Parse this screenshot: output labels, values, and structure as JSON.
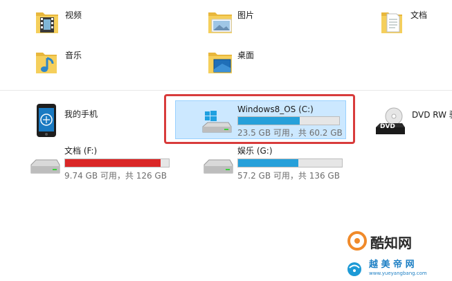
{
  "folders": [
    {
      "name": "视频",
      "icon": "video-folder-icon"
    },
    {
      "name": "图片",
      "icon": "pictures-folder-icon"
    },
    {
      "name": "文档",
      "icon": "documents-folder-icon"
    },
    {
      "name": "音乐",
      "icon": "music-folder-icon"
    },
    {
      "name": "桌面",
      "icon": "desktop-folder-icon"
    }
  ],
  "devices": {
    "phone": {
      "name": "我的手机",
      "icon": "phone-icon"
    },
    "drive_c": {
      "name": "Windows8_OS (C:)",
      "free": "23.5 GB 可用，共 60.2 GB",
      "usage": 0.61,
      "bar_color": "#26a0da"
    },
    "dvd": {
      "name": "DVD RW 驱",
      "icon": "dvd-drive-icon",
      "badge": "DVD"
    },
    "drive_f": {
      "name": "文档 (F:)",
      "free": "9.74 GB 可用，共 126 GB",
      "usage": 0.92,
      "bar_color": "#da2626"
    },
    "drive_g": {
      "name": "娱乐 (G:)",
      "free": "57.2 GB 可用，共 136 GB",
      "usage": 0.58,
      "bar_color": "#26a0da"
    }
  },
  "watermark": {
    "brand1": "酷知网",
    "brand2": "越 美 帝 网",
    "url": "www.yueyangbang.com"
  },
  "colors": {
    "selection_border": "#d83b3b",
    "selection_fill": "#cce8ff",
    "folder_yellow": "#f2c84b"
  }
}
